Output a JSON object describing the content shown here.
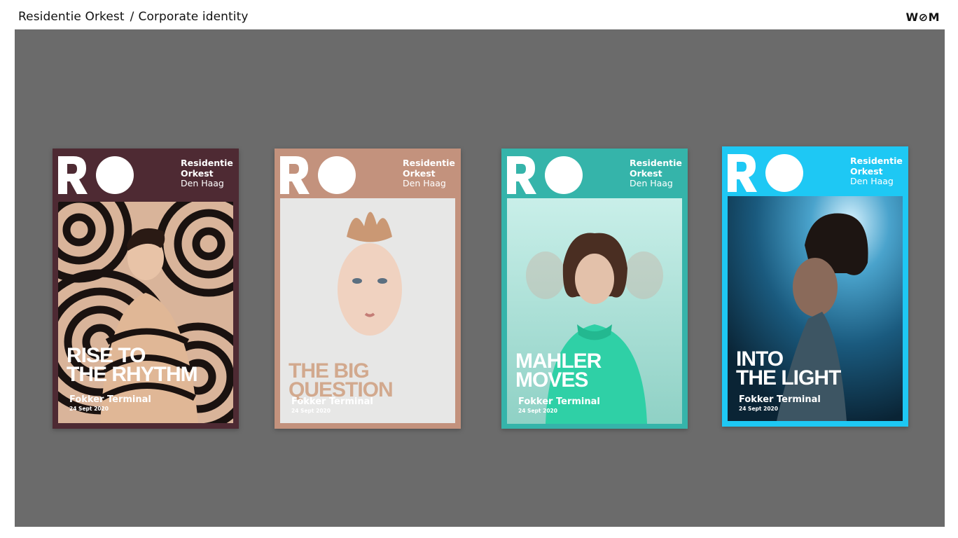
{
  "header": {
    "client": "Residentie Orkest",
    "separator": "/",
    "section": "Corporate identity",
    "studio_logo": "W⊘M"
  },
  "posters": [
    {
      "brand_line1": "Residentie",
      "brand_line2": "Orkest",
      "city": "Den Haag",
      "headline": "RISE TO\nTHE RHYTHM",
      "venue": "Fokker Terminal",
      "date": "24 Sept 2020",
      "frame_color": "#4e2a33",
      "headline_color": "#ffffff"
    },
    {
      "brand_line1": "Residentie",
      "brand_line2": "Orkest",
      "city": "Den Haag",
      "headline": "THE BIG\nQUESTION",
      "venue": "Fokker Terminal",
      "date": "24 Sept 2020",
      "frame_color": "#c3927d",
      "headline_color": "#d2a98e"
    },
    {
      "brand_line1": "Residentie",
      "brand_line2": "Orkest",
      "city": "Den Haag",
      "headline": "MAHLER\nMOVES",
      "venue": "Fokker Terminal",
      "date": "24 Sept 2020",
      "frame_color": "#35b4aa",
      "headline_color": "#ffffff"
    },
    {
      "brand_line1": "Residentie",
      "brand_line2": "Orkest",
      "city": "Den Haag",
      "headline": "INTO\nTHE LIGHT",
      "venue": "Fokker Terminal",
      "date": "24 Sept 2020",
      "frame_color": "#1ec8f4",
      "headline_color": "#ffffff"
    }
  ],
  "colors": {
    "stage_background": "#6b6b6b",
    "page_background": "#ffffff"
  }
}
